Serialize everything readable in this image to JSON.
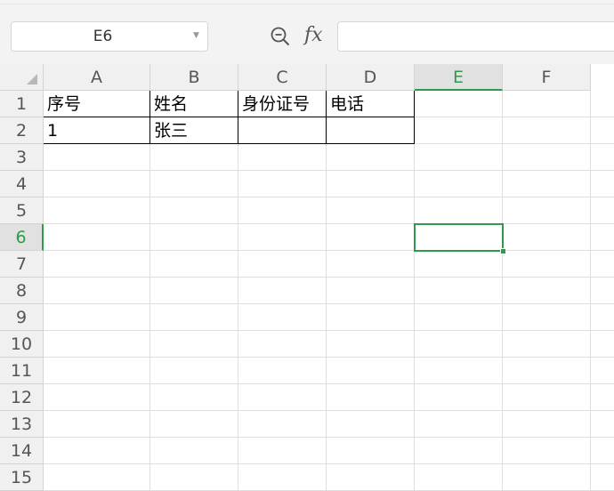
{
  "toolbar": {
    "name_box": "E6",
    "formula_value": ""
  },
  "icons": {
    "zoom": "zoom-icon",
    "function": "fx"
  },
  "columns": [
    "A",
    "B",
    "C",
    "D",
    "E",
    "F"
  ],
  "rows": [
    "1",
    "2",
    "3",
    "4",
    "5",
    "6",
    "7",
    "8",
    "9",
    "10",
    "11",
    "12",
    "13",
    "14",
    "15"
  ],
  "active_cell": {
    "column": "E",
    "row": "6"
  },
  "cells": {
    "A1": "序号",
    "B1": "姓名",
    "C1": "身份证号",
    "D1": "电话",
    "A2": "1",
    "B2": "张三"
  },
  "colors": {
    "accent": "#2f9a49",
    "header_bg": "#f0f0f0",
    "grid": "#dedede"
  }
}
